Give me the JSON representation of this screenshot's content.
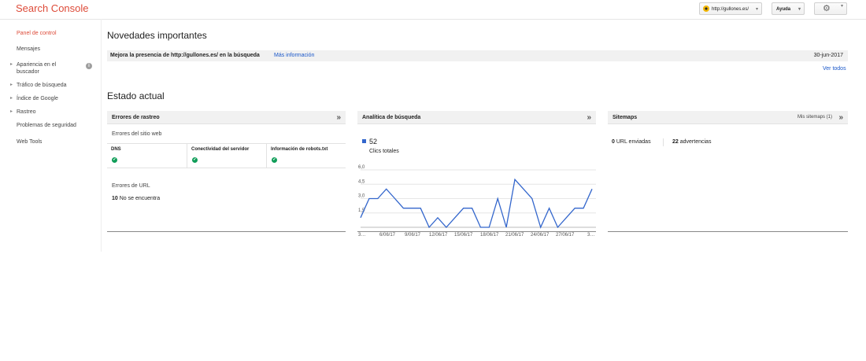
{
  "header": {
    "logo": "Search Console",
    "site": "http://gullones.es/",
    "help": "Ayuda"
  },
  "sidebar": {
    "items": [
      {
        "label": "Panel de control"
      },
      {
        "label": "Mensajes"
      },
      {
        "label": "Apariencia en el buscador"
      },
      {
        "label": "Tráfico de búsqueda"
      },
      {
        "label": "Índice de Google"
      },
      {
        "label": "Rastreo"
      },
      {
        "label": "Problemas de seguridad"
      },
      {
        "label": "Web Tools"
      }
    ],
    "info": "i"
  },
  "news": {
    "title": "Novedades importantes",
    "message": "Mejora la presencia de http://gullones.es/ en la búsqueda",
    "link": "Más información",
    "date": "30-jun-2017",
    "see_all": "Ver todos"
  },
  "estado": {
    "title": "Estado actual",
    "errores": {
      "title": "Errores de rastreo",
      "subtitle": "Errores del sitio web",
      "columns": [
        "DNS",
        "Conectividad del servidor",
        "Información de robots.txt"
      ],
      "url_title": "Errores de URL",
      "url_count": "10",
      "url_text": "No se encuentra"
    },
    "analitica": {
      "title": "Analítica de búsqueda",
      "clicks": "52",
      "clicks_label": "Clics totales"
    },
    "sitemaps": {
      "title": "Sitemaps",
      "link": "Mis sitemaps (1)",
      "url_count": "0",
      "url_label": "URL enviadas",
      "warn_count": "22",
      "warn_label": "advertencias"
    }
  },
  "chart_data": {
    "type": "line",
    "series": [
      {
        "values": [
          1,
          3,
          3,
          4,
          3,
          2,
          2,
          2,
          0,
          1,
          0,
          1,
          2,
          2,
          0,
          0,
          3,
          0,
          5,
          4,
          3,
          0,
          2,
          0,
          1,
          2,
          2,
          4
        ]
      }
    ],
    "y_ticks": [
      "6,0",
      "4,5",
      "3,0",
      "1,5"
    ],
    "x_ticks": [
      "3…",
      "6/06/17",
      "9/06/17",
      "12/06/17",
      "15/06/17",
      "18/06/17",
      "21/06/17",
      "24/06/17",
      "27/06/17",
      "3…"
    ],
    "ylim": [
      0,
      6
    ],
    "grid": true,
    "color": "#3366cc"
  }
}
